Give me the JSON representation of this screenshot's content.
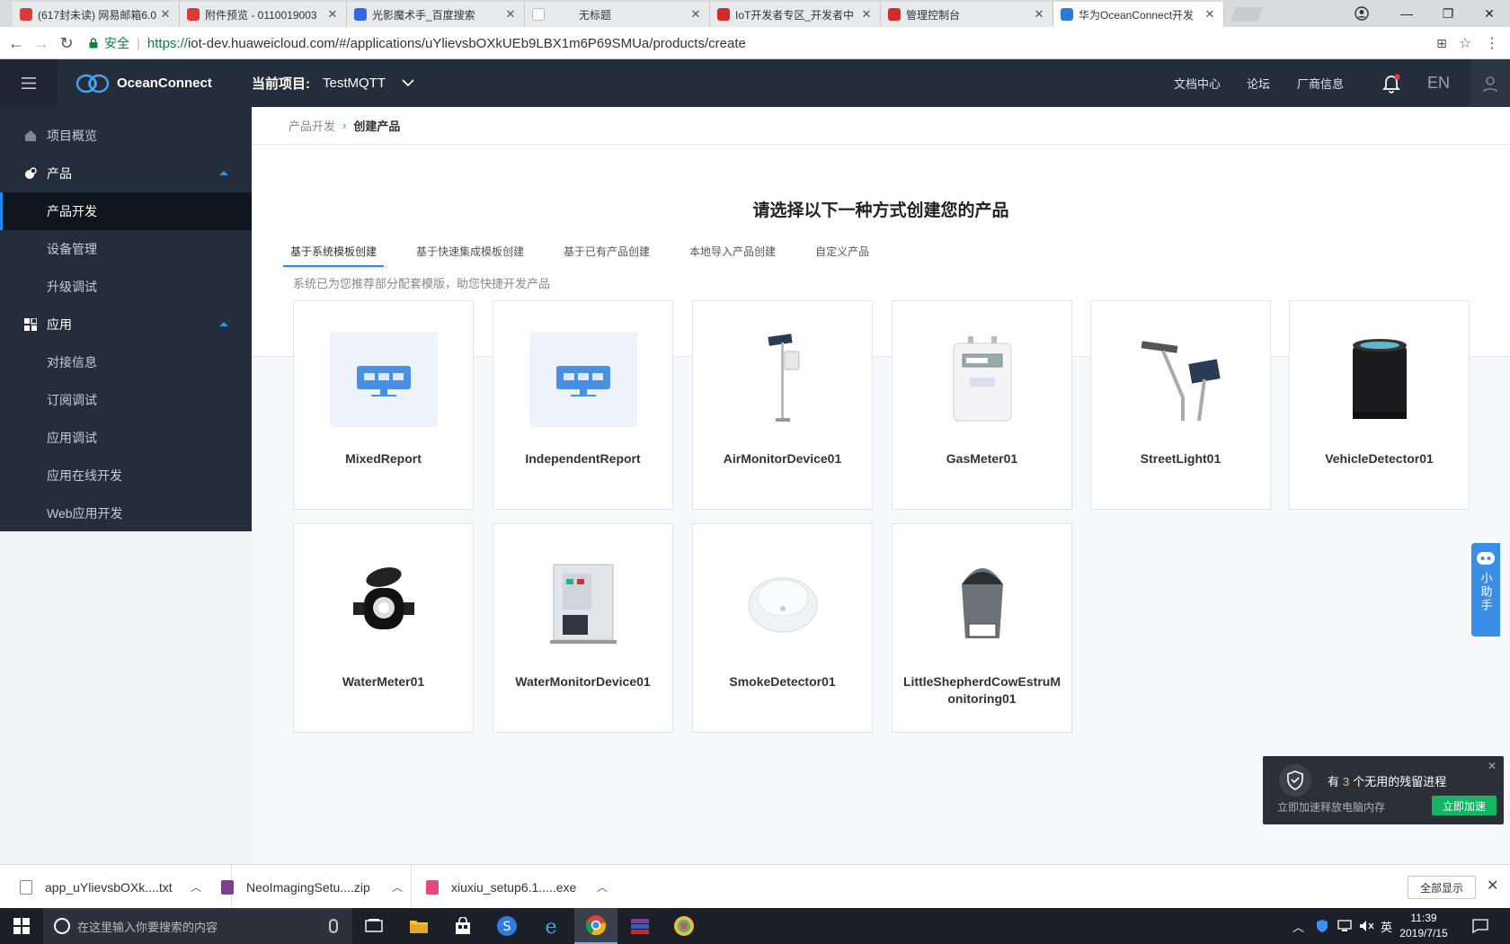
{
  "browser": {
    "tabs": [
      {
        "title": "(617封未读) 网易邮箱6.0",
        "color": "#d93a3a"
      },
      {
        "title": "附件预览 - 0110019003",
        "color": "#d93a3a"
      },
      {
        "title": "光影魔术手_百度搜索",
        "color": "#2d6be4"
      },
      {
        "title": "无标题",
        "color": "#ffffff"
      },
      {
        "title": "IoT开发者专区_开发者中",
        "color": "#cf2b2b"
      },
      {
        "title": "管理控制台",
        "color": "#cf2b2b"
      },
      {
        "title": "华为OceanConnect开发",
        "color": "#2a7ad8"
      }
    ],
    "secure_label": "安全",
    "url_scheme": "https://",
    "url_host": "iot-dev.huaweicloud.com",
    "url_path": "/#/applications/uYlievsbOXkUEb9LBX1m6P69SMUa/products/create"
  },
  "topnav": {
    "brand": "OceanConnect",
    "project_label": "当前项目:",
    "project_name": "TestMQTT",
    "links": [
      "文档中心",
      "论坛",
      "厂商信息"
    ],
    "lang": "EN"
  },
  "sidebar": {
    "items": [
      {
        "label": "项目概览",
        "type": "item"
      },
      {
        "label": "产品",
        "type": "group"
      },
      {
        "label": "产品开发",
        "type": "sub-active"
      },
      {
        "label": "设备管理",
        "type": "sub"
      },
      {
        "label": "升级调试",
        "type": "sub"
      },
      {
        "label": "应用",
        "type": "group"
      },
      {
        "label": "对接信息",
        "type": "sub"
      },
      {
        "label": "订阅调试",
        "type": "sub"
      },
      {
        "label": "应用调试",
        "type": "sub"
      },
      {
        "label": "应用在线开发",
        "type": "sub"
      },
      {
        "label": "Web应用开发",
        "type": "sub"
      }
    ]
  },
  "breadcrumb": {
    "parent": "产品开发",
    "current": "创建产品"
  },
  "main": {
    "headline": "请选择以下一种方式创建您的产品",
    "tabs": [
      "基于系统模板创建",
      "基于快速集成模板创建",
      "基于已有产品创建",
      "本地导入产品创建",
      "自定义产品"
    ],
    "hint": "系统已为您推荐部分配套模版，助您快捷开发产品",
    "cards": [
      {
        "name": "MixedReport",
        "icon": "report-icon"
      },
      {
        "name": "IndependentReport",
        "icon": "report-icon"
      },
      {
        "name": "AirMonitorDevice01",
        "icon": "air-monitor-icon"
      },
      {
        "name": "GasMeter01",
        "icon": "gas-meter-icon"
      },
      {
        "name": "StreetLight01",
        "icon": "street-light-icon"
      },
      {
        "name": "VehicleDetector01",
        "icon": "vehicle-detector-icon"
      },
      {
        "name": "WaterMeter01",
        "icon": "water-meter-icon"
      },
      {
        "name": "WaterMonitorDevice01",
        "icon": "water-monitor-icon"
      },
      {
        "name": "SmokeDetector01",
        "icon": "smoke-detector-icon"
      },
      {
        "name": "LittleShepherdCowEstruMonitoring01",
        "icon": "cow-monitor-icon"
      }
    ]
  },
  "assistant": {
    "label": "小助手"
  },
  "popup": {
    "prefix": "有",
    "count": "3",
    "suffix": "个无用的残留进程",
    "subtitle": "立即加速释放电脑内存",
    "button": "立即加速"
  },
  "downloads": {
    "files": [
      "app_uYlievsbOXk....txt",
      "NeoImagingSetu....zip",
      "xiuxiu_setup6.1.....exe"
    ],
    "show_all": "全部显示"
  },
  "taskbar": {
    "search_placeholder": "在这里输入你要搜索的内容",
    "ime": "英",
    "time": "11:39",
    "date": "2019/7/15"
  },
  "colors": {
    "accent": "#1e89f0",
    "nav_bg": "#232d3b",
    "popup_btn": "#17b466"
  }
}
